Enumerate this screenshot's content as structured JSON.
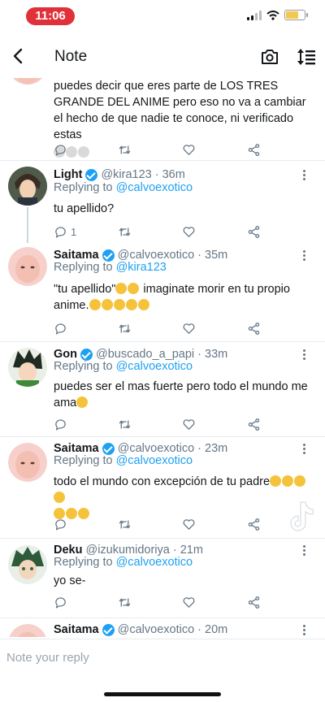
{
  "status_bar": {
    "time": "11:06"
  },
  "header": {
    "title": "Note"
  },
  "top_tweet": {
    "text": "puedes decir que eres parte de LOS TRES GRANDE DEL ANIME pero eso no va a cambiar el hecho de que nadie te conoce, ni verificado estas"
  },
  "tweets": [
    {
      "name": "Light",
      "meta": "@kira123 · 36m",
      "replying_label": "Replying to",
      "replying_to": "@calvoexotico",
      "text": "tu apellido?",
      "reply_count": "1"
    },
    {
      "name": "Saitama",
      "meta": "@calvoexotico · 35m",
      "replying_label": "Replying to",
      "replying_to": "@kira123",
      "text_a": "\"tu apellido\"",
      "text_b": " imaginate morir en tu propio",
      "text_c": "anime."
    },
    {
      "name": "Gon",
      "meta": "@buscado_a_papi · 33m",
      "replying_label": "Replying to",
      "replying_to": "@calvoexotico",
      "text_a": "puedes ser el mas fuerte pero todo el mundo me",
      "text_b": "ama"
    },
    {
      "name": "Saitama",
      "meta": "@calvoexotico · 23m",
      "replying_label": "Replying to",
      "replying_to": "@calvoexotico",
      "text": "todo el mundo con excepción de tu padre"
    },
    {
      "name": "Deku",
      "meta": "@izukumidoriya · 21m",
      "replying_label": "Replying to",
      "replying_to": "@calvoexotico",
      "text": "yo se-"
    },
    {
      "name": "Saitama",
      "meta": "@calvoexotico · 20m"
    }
  ],
  "reply_bar": {
    "placeholder": "Note your reply"
  },
  "colors": {
    "accent": "#1da1f2",
    "status_time_bg": "#e0313a",
    "muted": "#657786"
  },
  "icons": [
    "back-arrow-icon",
    "camera-icon",
    "sort-icon",
    "reply-icon",
    "retweet-icon",
    "like-icon",
    "share-icon",
    "more-icon",
    "verified-icon",
    "tiktok-icon"
  ]
}
